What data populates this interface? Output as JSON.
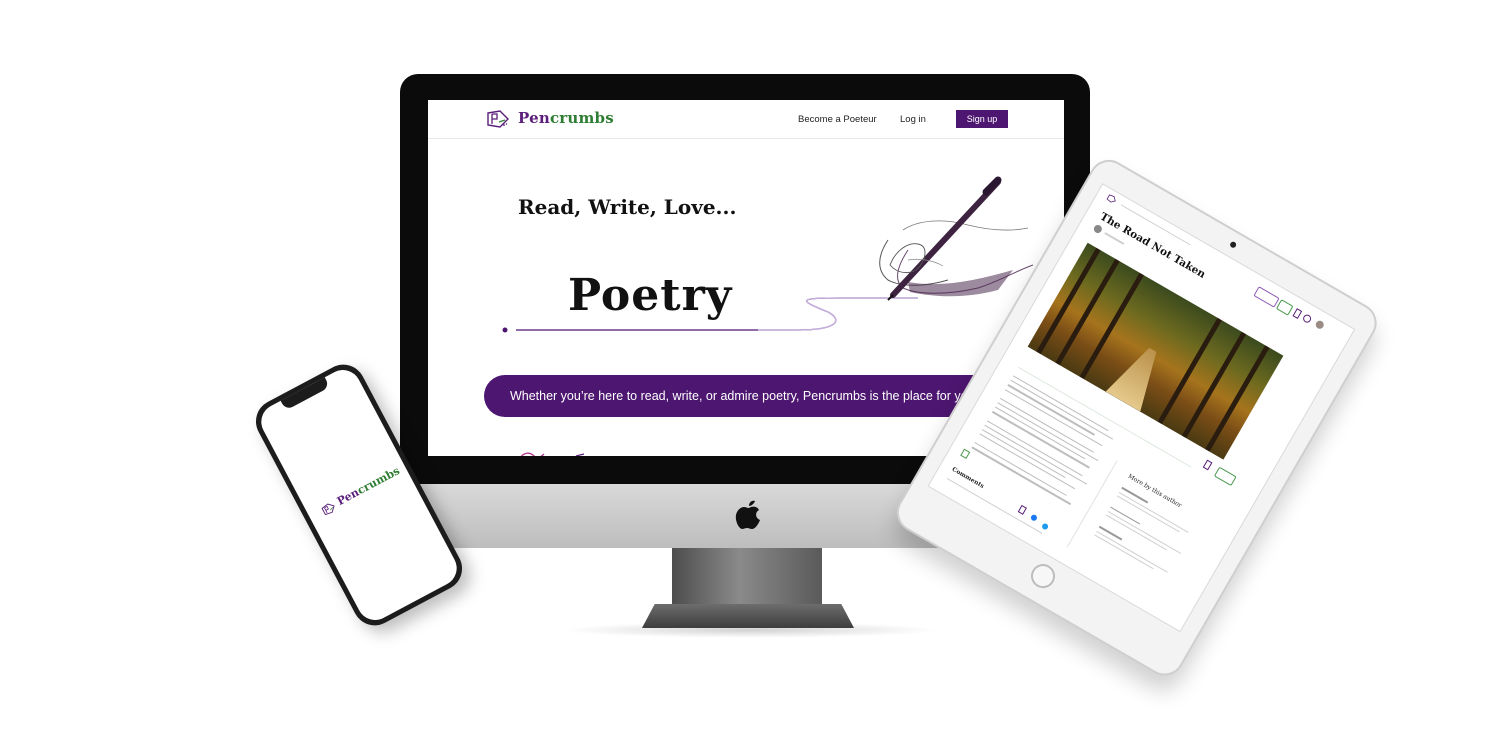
{
  "imac": {
    "site": {
      "brand": {
        "part1": "Pen",
        "part2": "crumbs"
      },
      "nav": {
        "become_poeteur": "Become a Poeteur",
        "login": "Log in",
        "signup": "Sign up"
      },
      "hero": {
        "heading": "Read, Write, Love...",
        "word": "Poetry",
        "tagline": "Whether you’re here to read, write, or admire poetry, Pencrumbs is the place for you."
      }
    }
  },
  "phone": {
    "brand": {
      "part1": "Pen",
      "part2": "crumbs"
    }
  },
  "tablet": {
    "poem_title": "The Road Not Taken",
    "comments_heading": "Comments",
    "more_by_author": "More by this author"
  },
  "colors": {
    "brand_purple": "#4d1670",
    "brand_green": "#2f7d32"
  }
}
